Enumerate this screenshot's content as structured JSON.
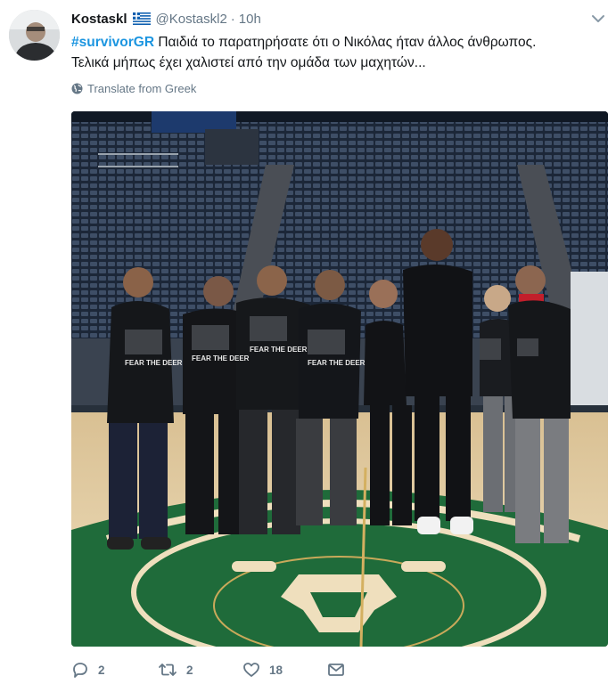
{
  "tweet": {
    "author_name": "Kostaskl",
    "author_handle": "@Kostaskl2",
    "separator": "·",
    "time": "10h",
    "hashtag": "#survivorGR",
    "text_line1": " Παιδιά το παρατηρήσατε ότι ο Νικόλας ήταν άλλος άνθρωπος.",
    "text_line2": "Τελικά μήπως έχει χαλιστεί από την ομάδα των μαχητών...",
    "translate_label": "Translate from Greek",
    "photo_text": "FEAR THE DEER"
  },
  "actions": {
    "reply_count": "2",
    "retweet_count": "2",
    "like_count": "18"
  },
  "icons": {
    "flag": "greece-flag-icon",
    "caret": "chevron-down-icon",
    "translate": "globe-icon",
    "reply": "reply-icon",
    "retweet": "retweet-icon",
    "like": "heart-icon",
    "message": "envelope-icon"
  },
  "colors": {
    "link": "#1b95e0",
    "secondary": "#657786",
    "court_green": "#1f6b3a",
    "court_wood": "#e8d5aa"
  }
}
